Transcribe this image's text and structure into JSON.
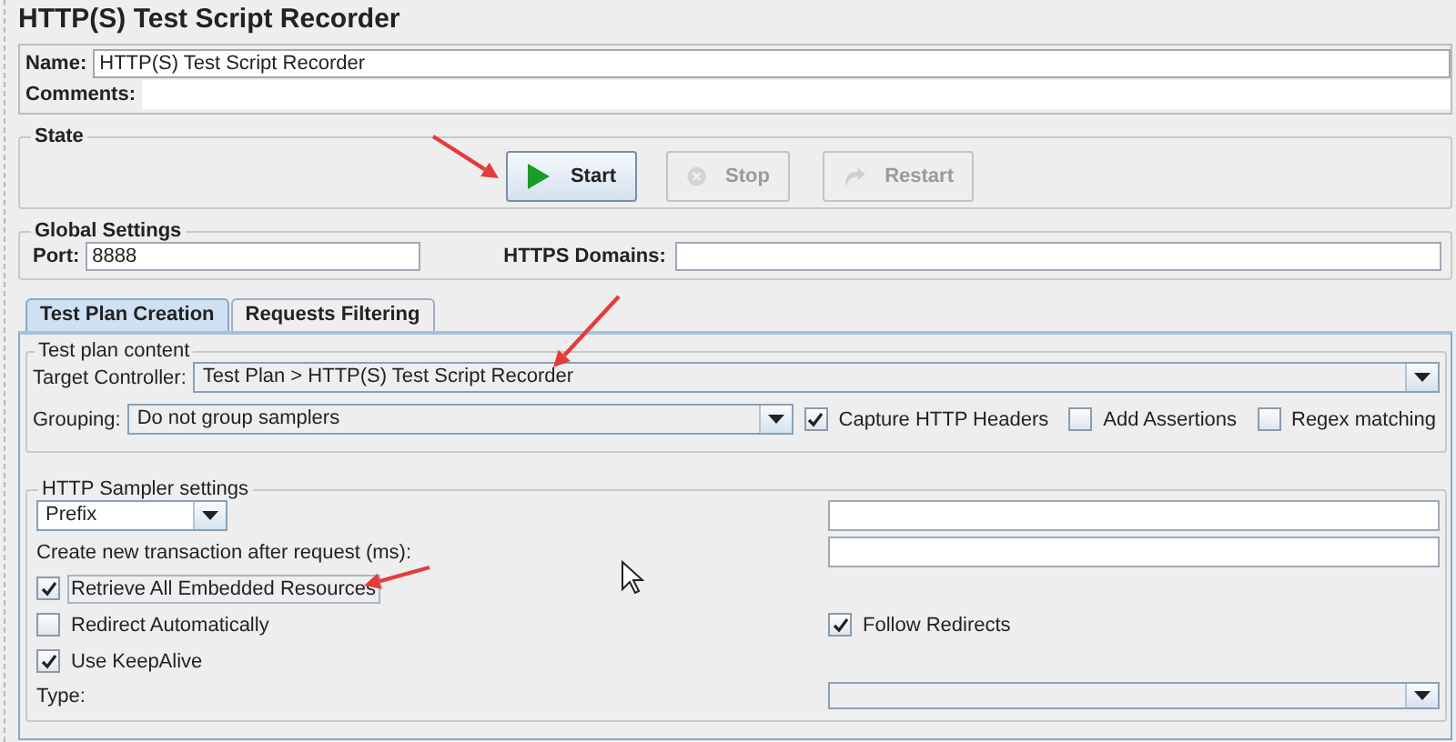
{
  "window": {
    "title": "HTTP(S) Test Script Recorder"
  },
  "name": {
    "label": "Name:",
    "value": "HTTP(S) Test Script Recorder"
  },
  "comments": {
    "label": "Comments:"
  },
  "state": {
    "title": "State",
    "buttons": [
      {
        "label": "Start",
        "kind": "start",
        "disabled": false
      },
      {
        "label": "Stop",
        "kind": "stop",
        "disabled": true
      },
      {
        "label": "Restart",
        "kind": "restart",
        "disabled": true
      }
    ]
  },
  "global_settings": {
    "title": "Global Settings",
    "port": {
      "label": "Port:",
      "value": "8888"
    },
    "https_domains": {
      "label": "HTTPS Domains:"
    }
  },
  "tabs": [
    {
      "label": "Test Plan Creation",
      "selected": true
    },
    {
      "label": "Requests Filtering",
      "selected": false
    }
  ],
  "test_plan_content": {
    "title": "Test plan content",
    "target_controller": {
      "label": "Target Controller:",
      "value": "Test Plan > HTTP(S) Test Script Recorder"
    },
    "grouping": {
      "label": "Grouping:",
      "value": "Do not group samplers"
    },
    "options": [
      {
        "label": "Capture HTTP Headers",
        "checked": true
      },
      {
        "label": "Add Assertions",
        "checked": false
      },
      {
        "label": "Regex matching",
        "checked": false
      }
    ]
  },
  "http_sampler_settings": {
    "title": "HTTP Sampler settings",
    "naming": {
      "value": "Prefix"
    },
    "transaction": {
      "label": "Create new transaction after request (ms):"
    },
    "checkbox_rows": [
      [
        {
          "label": "Retrieve All Embedded Resources",
          "checked": true,
          "focused": true
        }
      ],
      [
        {
          "label": "Redirect Automatically",
          "checked": false,
          "focused": false
        },
        {
          "label": "Follow Redirects",
          "checked": true,
          "focused": false
        }
      ],
      [
        {
          "label": "Use KeepAlive",
          "checked": true,
          "focused": false
        }
      ]
    ],
    "type": {
      "label": "Type:"
    }
  }
}
